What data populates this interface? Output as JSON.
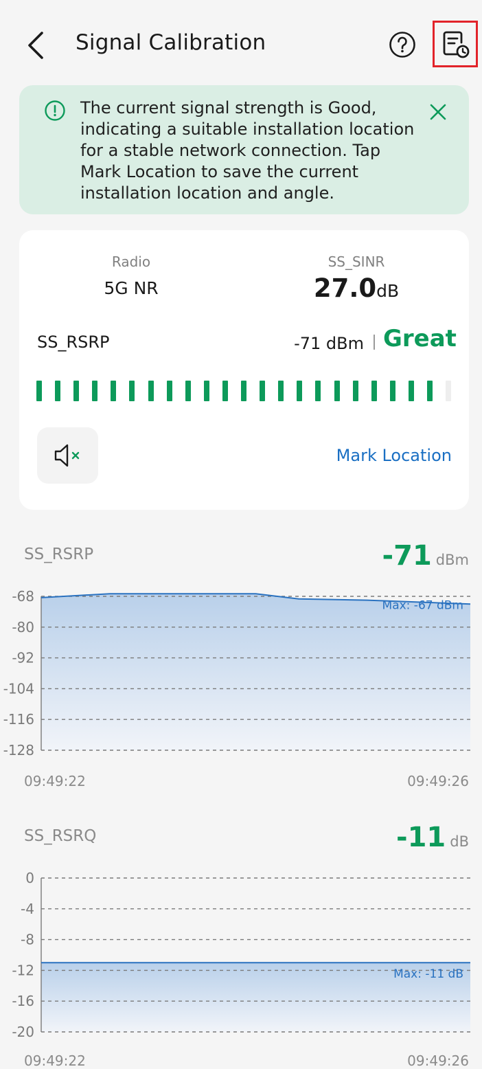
{
  "header": {
    "title": "Signal Calibration",
    "back_icon": "chevron-left-icon",
    "help_icon": "question-circle-icon",
    "history_icon": "document-clock-icon"
  },
  "banner": {
    "text": "The current signal strength is Good, indicating a suitable installation location for a stable network connection. Tap Mark Location to save the current installation location and angle.",
    "icon": "info-circle-icon",
    "close_icon": "close-icon",
    "bg_color": "#daeee4",
    "accent_color": "#0d9a5a"
  },
  "card": {
    "radio_label": "Radio",
    "radio_value": "5G NR",
    "sinr_label": "SS_SINR",
    "sinr_value": "27.0",
    "sinr_unit": "dB",
    "rsrp_label": "SS_RSRP",
    "rsrp_value": "-71 dBm",
    "rsrp_quality": "Great",
    "strength_segments_total": 23,
    "strength_segments_filled": 22,
    "mute_icon": "speaker-muted-icon",
    "mark_location_label": "Mark Location"
  },
  "colors": {
    "good_green": "#0d9a5a",
    "link_blue": "#1a6fc3",
    "chart_line": "#2a72c0",
    "chart_fill_top": "#b9d0ea",
    "chart_fill_bottom": "#f1f4f9"
  },
  "rsrp_chart": {
    "title": "SS_RSRP",
    "current_value": "-71",
    "unit": "dBm",
    "max_label": "Max: -67 dBm",
    "time_start": "09:49:22",
    "time_end": "09:49:26",
    "chart_data": {
      "type": "area",
      "ylim": [
        -128,
        -68
      ],
      "y_ticks": [
        "-68",
        "-80",
        "-92",
        "-104",
        "-116",
        "-128"
      ],
      "x": [
        0,
        0.16,
        0.5,
        0.6,
        0.76,
        1.0
      ],
      "values": [
        -68.5,
        -67,
        -67,
        -69,
        -69.5,
        -71
      ]
    }
  },
  "rsrq_chart": {
    "title": "SS_RSRQ",
    "current_value": "-11",
    "unit": "dB",
    "max_label": "Max: -11 dB",
    "time_start": "09:49:22",
    "time_end": "09:49:26",
    "chart_data": {
      "type": "area",
      "ylim": [
        -20,
        0
      ],
      "y_ticks": [
        "0",
        "-4",
        "-8",
        "-12",
        "-16",
        "-20"
      ],
      "x": [
        0,
        1.0
      ],
      "values": [
        -11,
        -11
      ]
    }
  }
}
